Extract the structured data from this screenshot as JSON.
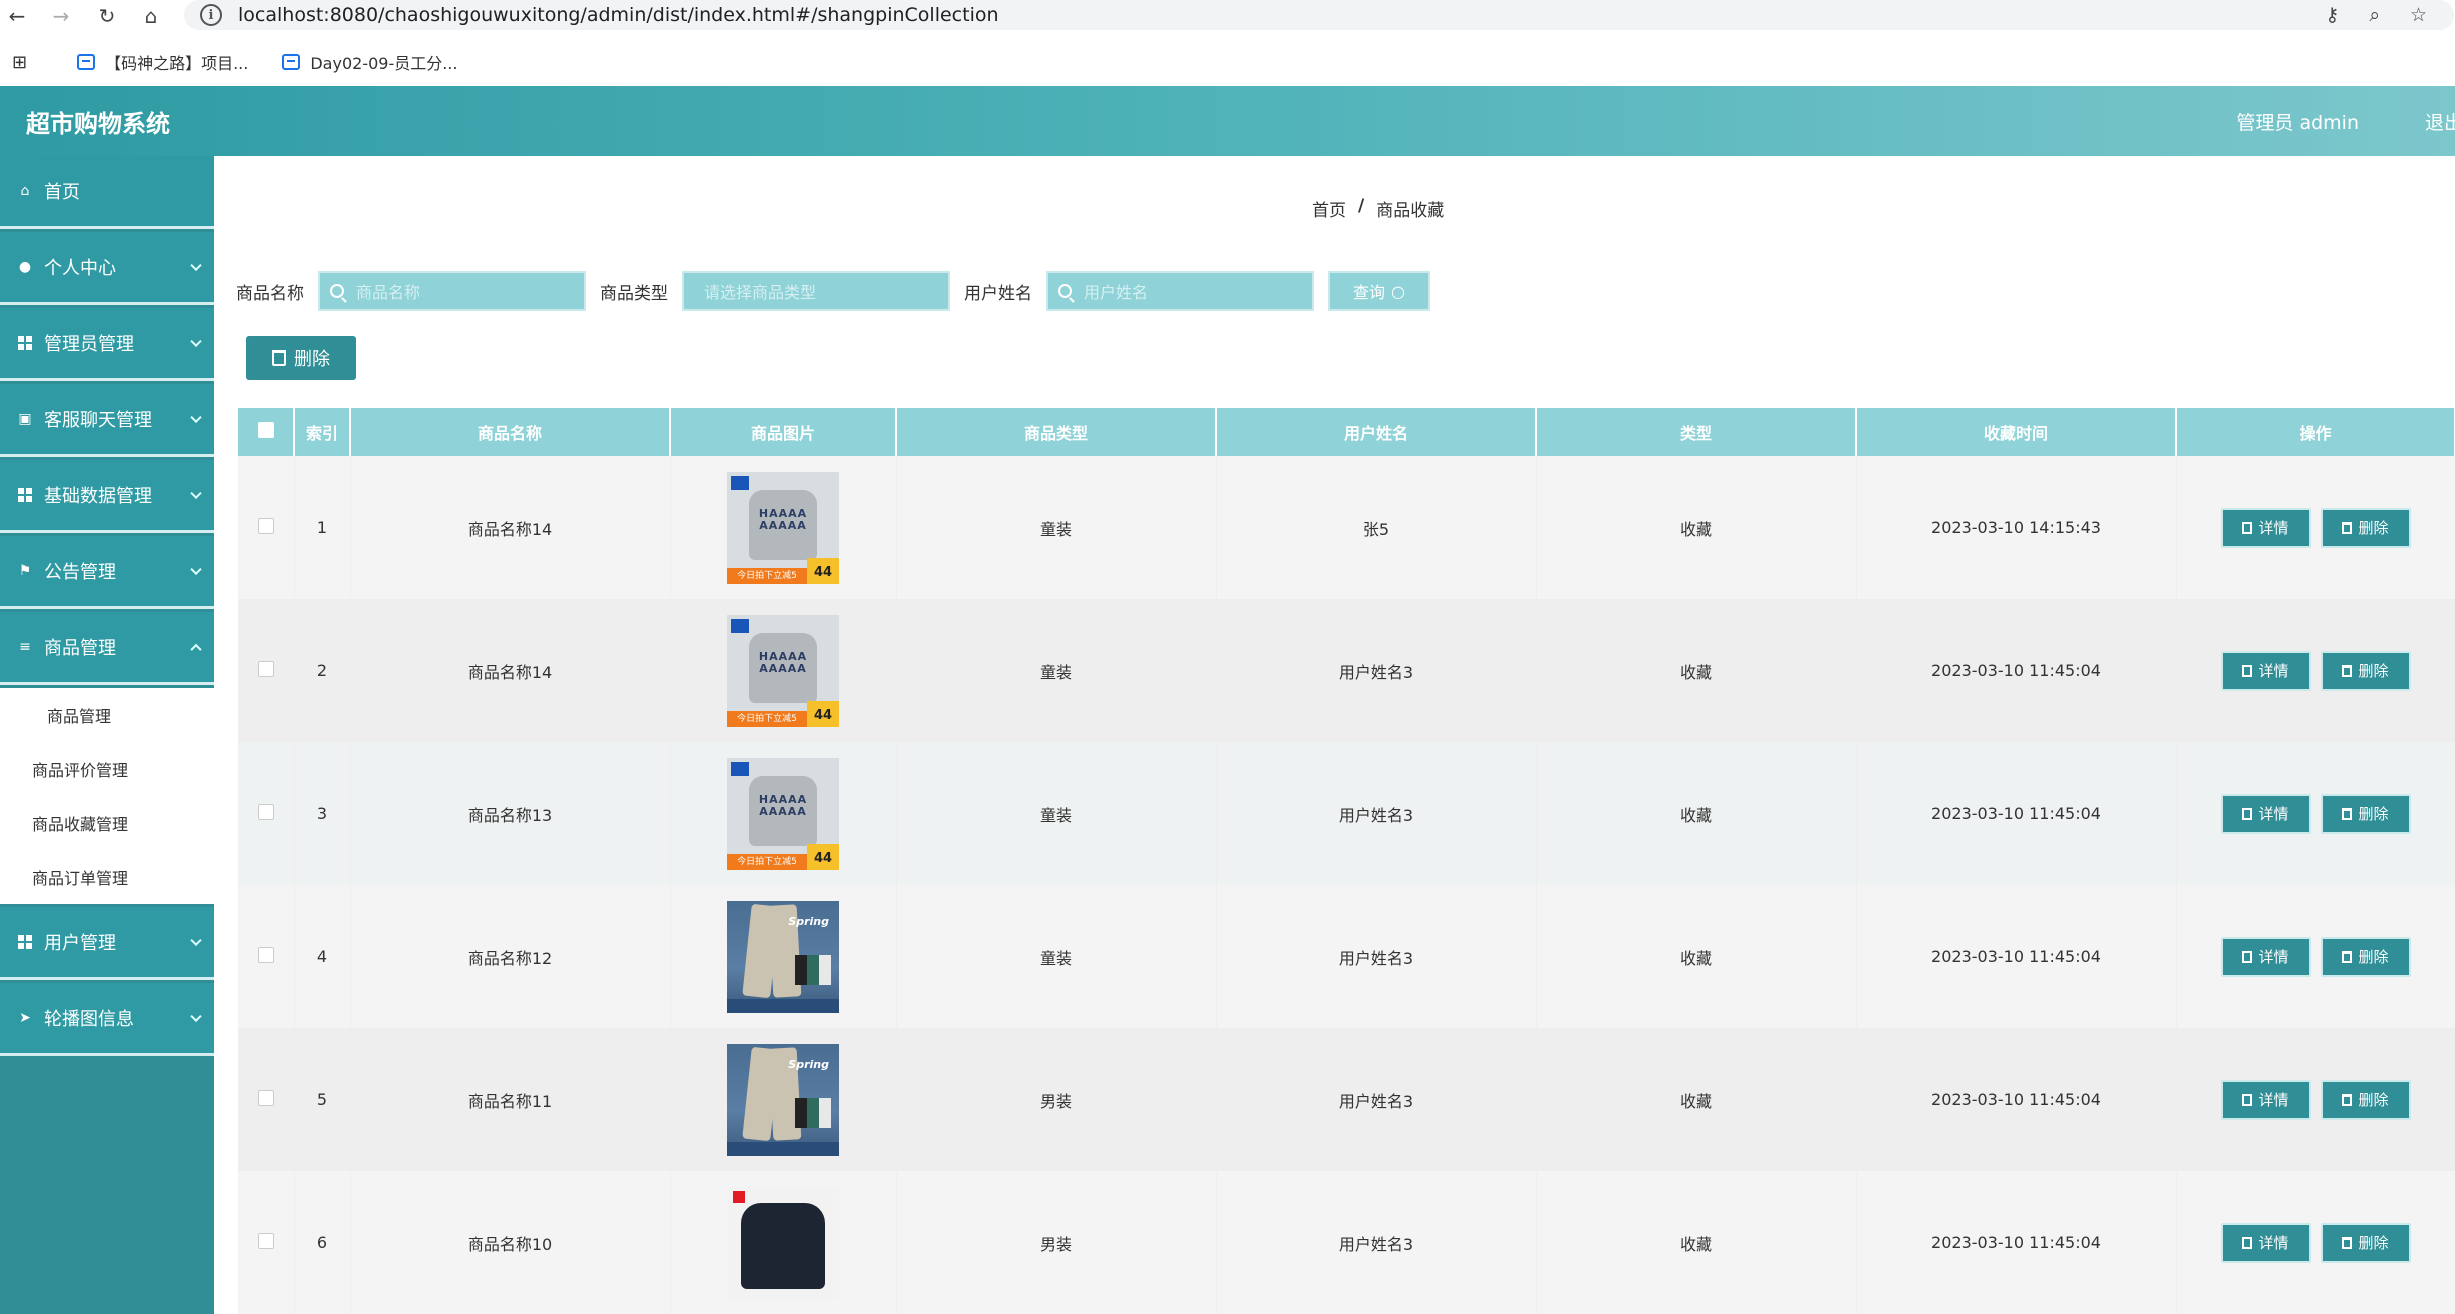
{
  "browser": {
    "url": "localhost:8080/chaoshigouwuxitong/admin/dist/index.html#/shangpinCollection",
    "bookmarks": [
      "【码神之路】项目...",
      "Day02-09-员工分..."
    ]
  },
  "header": {
    "title": "超市购物系统",
    "user": "管理员 admin",
    "logout": "退出"
  },
  "sidebar": {
    "items": [
      {
        "label": "首页",
        "icon": "home-icon"
      },
      {
        "label": "个人中心",
        "icon": "user-icon"
      },
      {
        "label": "管理员管理",
        "icon": "grid-icon"
      },
      {
        "label": "客服聊天管理",
        "icon": "clipboard-icon"
      },
      {
        "label": "基础数据管理",
        "icon": "grid-icon"
      },
      {
        "label": "公告管理",
        "icon": "flag-icon"
      },
      {
        "label": "商品管理",
        "icon": "layers-icon"
      },
      {
        "label": "用户管理",
        "icon": "grid-icon"
      },
      {
        "label": "轮播图信息",
        "icon": "send-icon"
      }
    ],
    "submenu": [
      "商品管理",
      "商品评价管理",
      "商品收藏管理",
      "商品订单管理"
    ]
  },
  "breadcrumb": {
    "home": "首页",
    "sep": "/",
    "current": "商品收藏"
  },
  "search": {
    "name_label": "商品名称",
    "name_placeholder": "商品名称",
    "type_label": "商品类型",
    "type_placeholder": "请选择商品类型",
    "user_label": "用户姓名",
    "user_placeholder": "用户姓名",
    "query_label": "查询"
  },
  "toolbar": {
    "delete_label": "删除"
  },
  "table": {
    "headers": [
      "索引",
      "商品名称",
      "商品图片",
      "商品类型",
      "用户姓名",
      "类型",
      "收藏时间",
      "操作"
    ],
    "rows": [
      {
        "index": "1",
        "name": "商品名称14",
        "image": "sweater",
        "type": "童装",
        "user": "张5",
        "kind": "收藏",
        "time": "2023-03-10 14:15:43"
      },
      {
        "index": "2",
        "name": "商品名称14",
        "image": "sweater",
        "type": "童装",
        "user": "用户姓名3",
        "kind": "收藏",
        "time": "2023-03-10 11:45:04"
      },
      {
        "index": "3",
        "name": "商品名称13",
        "image": "sweater",
        "type": "童装",
        "user": "用户姓名3",
        "kind": "收藏",
        "time": "2023-03-10 11:45:04"
      },
      {
        "index": "4",
        "name": "商品名称12",
        "image": "pants",
        "type": "童装",
        "user": "用户姓名3",
        "kind": "收藏",
        "time": "2023-03-10 11:45:04"
      },
      {
        "index": "5",
        "name": "商品名称11",
        "image": "pants",
        "type": "男装",
        "user": "用户姓名3",
        "kind": "收藏",
        "time": "2023-03-10 11:45:04"
      },
      {
        "index": "6",
        "name": "商品名称10",
        "image": "black",
        "type": "男装",
        "user": "用户姓名3",
        "kind": "收藏",
        "time": "2023-03-10 11:45:04"
      }
    ],
    "detail_label": "详情",
    "delete_label": "删除",
    "sweater_ribbon": "今日拍下立减5",
    "sweater_price": "44",
    "pants_text": "Spring"
  },
  "colors": {
    "primary": "#2f8e96",
    "header": "#4fb3b9",
    "table_head": "#8fd2d7"
  }
}
